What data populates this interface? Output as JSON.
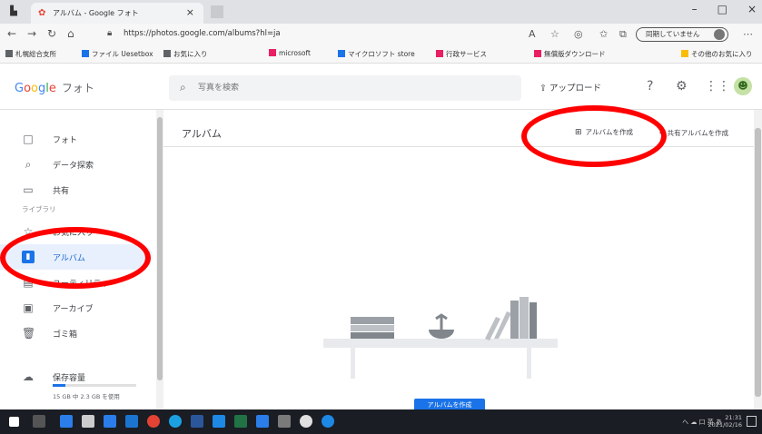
{
  "browser": {
    "tab_title": "アルバム - Google フォト",
    "url": "https://photos.google.com/albums?hl=ja",
    "sync_label": "同期していません",
    "win_min": "–",
    "win_max": "□",
    "win_close": "×",
    "tab_close": "×"
  },
  "bookmarks": [
    {
      "label": "札幌総合支所",
      "color": "#5f6368"
    },
    {
      "label": "ファイル Uesetbox",
      "color": "#1a73e8"
    },
    {
      "label": "お気に入り",
      "color": "#5f6368"
    },
    {
      "label": "microsoft",
      "color": "#e91e63"
    },
    {
      "label": "マイクロソフト store",
      "color": "#1a73e8"
    },
    {
      "label": "行政サービス",
      "color": "#e91e63"
    },
    {
      "label": "無償版ダウンロード",
      "color": "#e91e63"
    },
    {
      "label": "その他のお気に入り",
      "color": "#fbbc05"
    }
  ],
  "app": {
    "logo_letters": [
      "G",
      "o",
      "o",
      "g",
      "l",
      "e"
    ],
    "product": "フォト",
    "search_placeholder": "写真を検索",
    "upload_label": "アップロード"
  },
  "sidebar": {
    "items_top": [
      {
        "label": "フォト",
        "icon": "□"
      },
      {
        "label": "データ探索",
        "icon": "⌕"
      },
      {
        "label": "共有",
        "icon": "▭"
      }
    ],
    "section_label": "ライブラリ",
    "items_library": [
      {
        "label": "お気に入り",
        "icon": "☆"
      },
      {
        "label": "アルバム",
        "icon": "▮",
        "active": true
      },
      {
        "label": "ユーティリティ",
        "icon": "▤"
      },
      {
        "label": "アーカイブ",
        "icon": "▣"
      },
      {
        "label": "ゴミ箱",
        "icon": "🗑"
      }
    ],
    "storage_label": "保存容量",
    "storage_detail": "15 GB 中 2.3 GB を使用",
    "storage_fraction": 0.15
  },
  "main": {
    "title": "アルバム",
    "create_album": "アルバムを作成",
    "shared_album": "共有アルバムを作成",
    "cta": "アルバムを作成"
  },
  "taskbar": {
    "tray_text": "へ ☁ 口 英 あ",
    "time": "21:31",
    "date": "2021/02/16"
  },
  "colors": {
    "accent": "#1a73e8",
    "annotation": "#ff0000"
  }
}
